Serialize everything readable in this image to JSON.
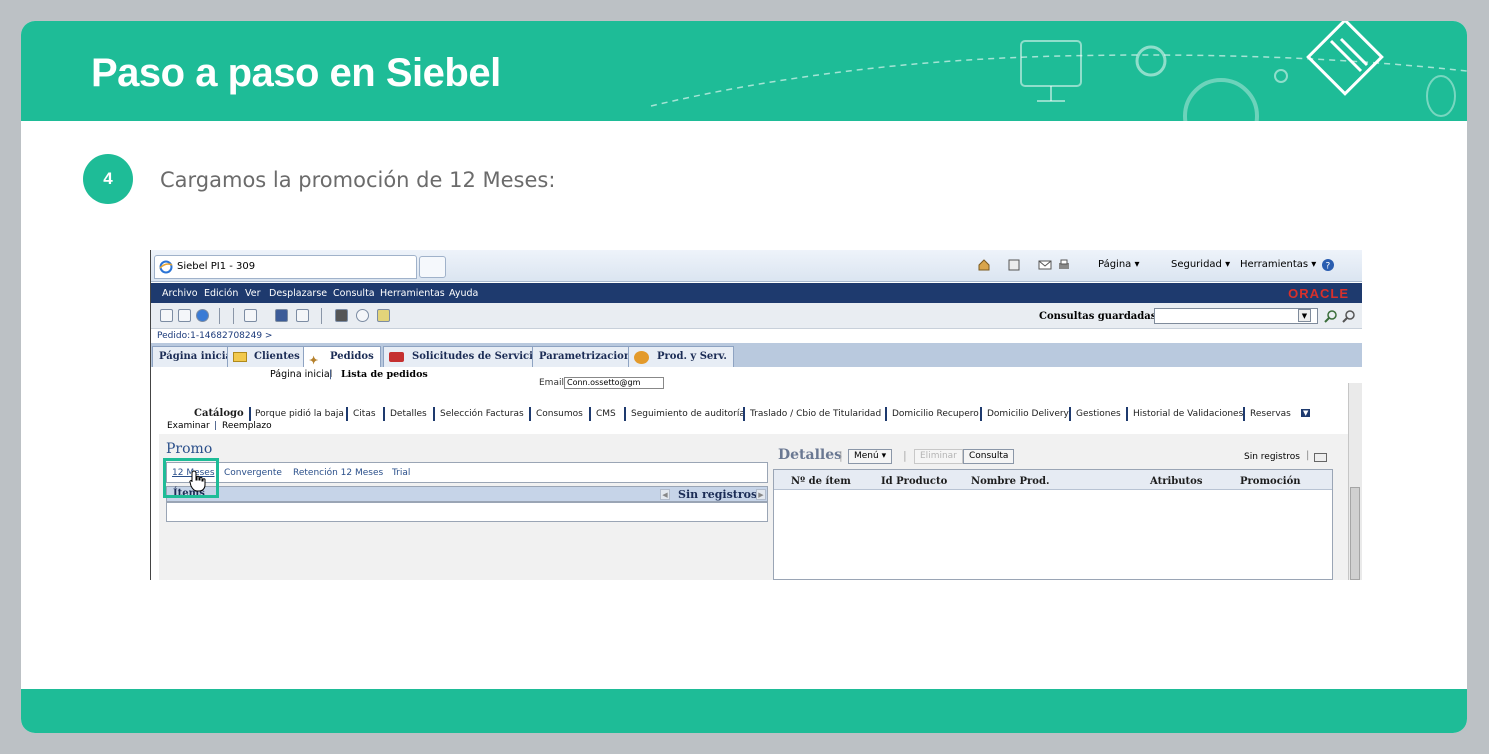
{
  "slide": {
    "title": "Paso a paso en Siebel",
    "step_number": "4",
    "step_text": "Cargamos la promoción de 12 Meses:",
    "accent_color": "#1ebc97"
  },
  "browser": {
    "tab_title": "Siebel PI1 - 309",
    "commands": [
      "Página ▾",
      "Seguridad ▾",
      "Herramientas ▾"
    ]
  },
  "menu": {
    "items": [
      "Archivo",
      "Edición",
      "Ver",
      "Desplazarse",
      "Consulta",
      "Herramientas",
      "Ayuda"
    ],
    "brand": "ORACLE"
  },
  "toolbar": {
    "saved_queries_label": "Consultas guardadas:"
  },
  "breadcrumb": "Pedido:1-14682708249  >",
  "main_tabs": [
    "Página inicial",
    "Clientes",
    "Pedidos",
    "Solicitudes de Servicio",
    "Parametrizacion",
    "Prod. y Serv."
  ],
  "subnav": {
    "home": "Página inicial",
    "current": "Lista de pedidos",
    "email_label": "Email:",
    "email_value": "Conn.ossetto@gm"
  },
  "view_tabs": [
    "Catálogo",
    "Porque pidió la baja",
    "Citas",
    "Detalles",
    "Selección Facturas",
    "Consumos",
    "CMS",
    "Seguimiento de auditoría",
    "Traslado / Cbio de Titularidad",
    "Domicilio Recupero",
    "Domicilio Delivery",
    "Gestiones",
    "Historial de Validaciones",
    "Reservas"
  ],
  "sub_links": [
    "Examinar",
    "Reemplazo"
  ],
  "promo": {
    "title": "Promo",
    "options": [
      "12 Meses",
      "Convergente",
      "Retención 12 Meses",
      "Trial"
    ],
    "items_label": "Ítems",
    "no_records": "Sin registros"
  },
  "details": {
    "title": "Detalles",
    "menu_button": "Menú ▾",
    "delete_button": "Eliminar",
    "query_button": "Consulta",
    "no_records": "Sin registros",
    "columns": [
      "Nº de ítem",
      "Id Producto",
      "Nombre Prod.",
      "Atributos",
      "Promoción"
    ]
  }
}
